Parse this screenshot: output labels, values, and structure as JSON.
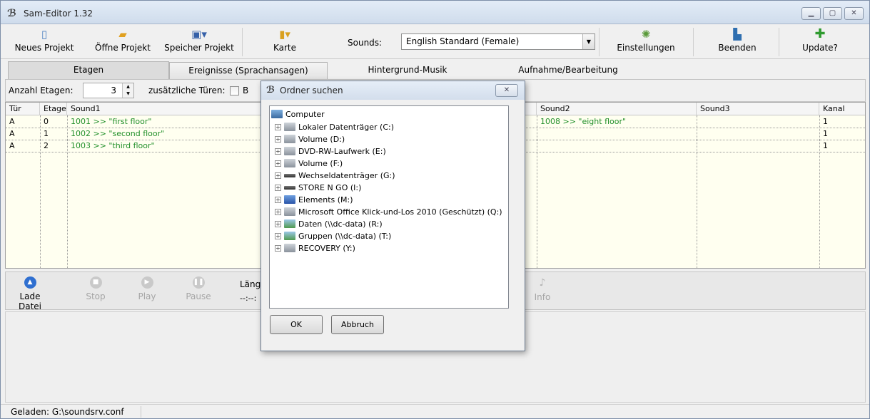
{
  "window": {
    "title": "Sam-Editor 1.32"
  },
  "toolbar": {
    "new_project": "Neues Projekt",
    "open_project": "Öffne Projekt",
    "save_project": "Speicher Projekt",
    "card": "Karte",
    "sounds_label": "Sounds:",
    "sounds_value": "English Standard (Female)",
    "settings": "Einstellungen",
    "exit": "Beenden",
    "update": "Update?"
  },
  "tabs": [
    {
      "label": "Etagen"
    },
    {
      "label": "Ereignisse (Sprachansagen)"
    },
    {
      "label": "Hintergrund-Musik"
    },
    {
      "label": "Aufnahme/Bearbeitung"
    }
  ],
  "options": {
    "floor_count_label": "Anzahl Etagen:",
    "floor_count_value": "3",
    "extra_doors_label": "zusätzliche Türen:",
    "extra_door_b": "B"
  },
  "table": {
    "headers": [
      "Tür",
      "Etage",
      "Sound1",
      "Sound2",
      "Sound3",
      "Kanal"
    ],
    "rows": [
      {
        "door": "A",
        "floor": "0",
        "sound1": "1001  >> \"first floor\"",
        "sound2": "1008  >> \"eight floor\"",
        "sound3": "",
        "channel": "1"
      },
      {
        "door": "A",
        "floor": "1",
        "sound1": "1002  >> \"second floor\"",
        "sound2": "",
        "sound3": "",
        "channel": "1"
      },
      {
        "door": "A",
        "floor": "2",
        "sound1": "1003  >> \"third floor\"",
        "sound2": "",
        "sound3": "",
        "channel": "1"
      }
    ]
  },
  "player": {
    "load": "Lade Datei",
    "stop": "Stop",
    "play": "Play",
    "pause": "Pause",
    "length_label": "Läng",
    "length_value": "--:--:",
    "info": "Info"
  },
  "status": {
    "loaded": "Geladen:  G:\\soundsrv.conf"
  },
  "dialog": {
    "title": "Ordner suchen",
    "root": "Computer",
    "items": [
      "Lokaler Datenträger (C:)",
      "Volume (D:)",
      "DVD-RW-Laufwerk (E:)",
      "Volume (F:)",
      "Wechseldatenträger (G:)",
      "STORE N GO (I:)",
      "Elements (M:)",
      "Microsoft Office Klick-und-Los 2010 (Geschützt) (Q:)",
      "Daten (\\\\dc-data) (R:)",
      "Gruppen (\\\\dc-data) (T:)",
      "RECOVERY (Y:)"
    ],
    "ok": "OK",
    "cancel": "Abbruch"
  }
}
